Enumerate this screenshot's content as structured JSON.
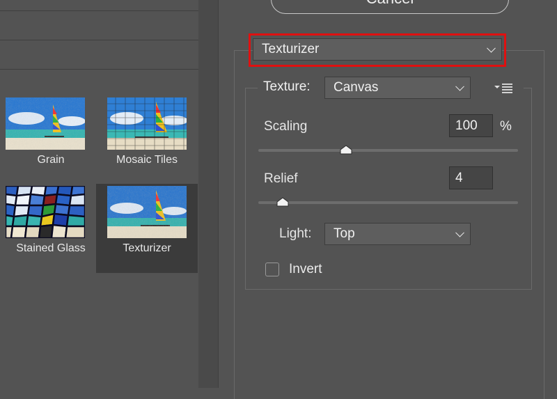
{
  "gallery": {
    "items": [
      {
        "label": "Grain"
      },
      {
        "label": "Mosaic Tiles"
      },
      {
        "label": "Stained Glass"
      },
      {
        "label": "Texturizer",
        "selected": true
      }
    ]
  },
  "cancel_button": {
    "label": "Cancel"
  },
  "filter_select": {
    "value": "Texturizer"
  },
  "texture": {
    "label": "Texture:",
    "value": "Canvas",
    "scaling": {
      "label": "Scaling",
      "value": "100",
      "unit": "%",
      "level_fraction": 0.33
    },
    "relief": {
      "label": "Relief",
      "value": "4",
      "level_fraction": 0.09
    },
    "light": {
      "label": "Light:",
      "value": "Top"
    },
    "invert": {
      "label": "Invert",
      "checked": false
    }
  },
  "colors": {
    "highlight": "#e01010",
    "panel": "#535353"
  }
}
